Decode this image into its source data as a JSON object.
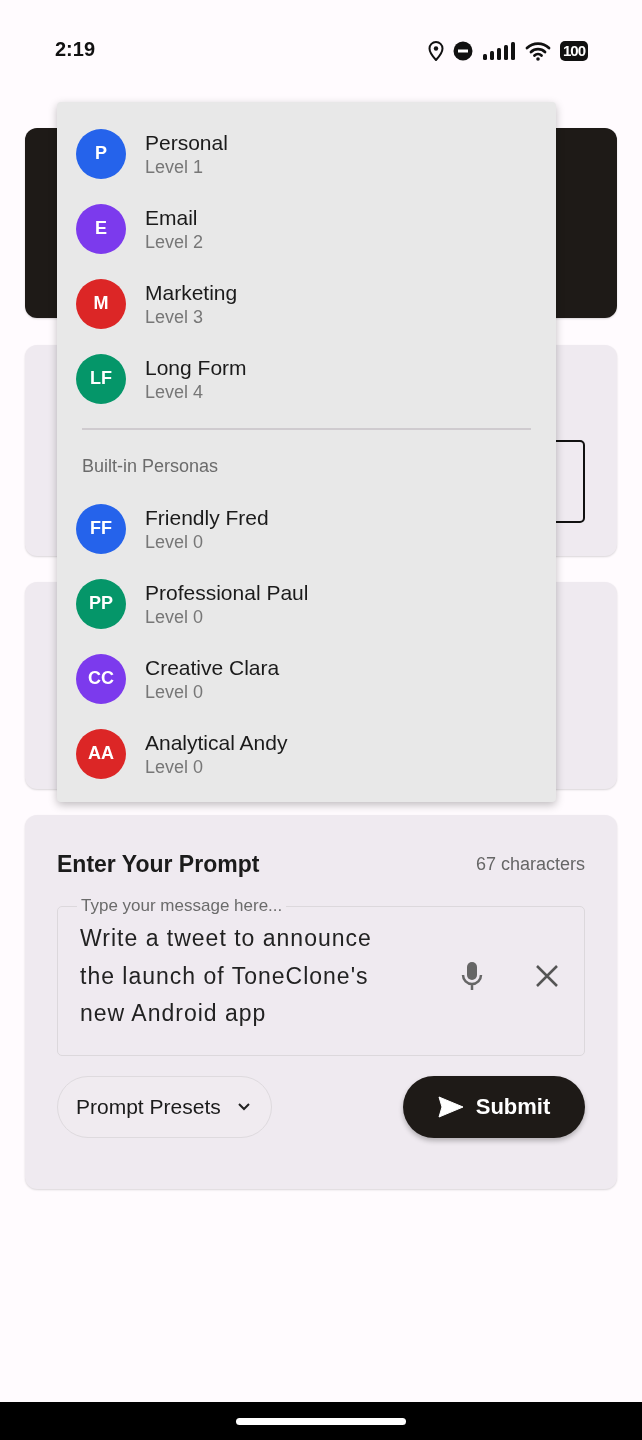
{
  "status_bar": {
    "time": "2:19",
    "battery": "100"
  },
  "persona_menu": {
    "open": true,
    "custom_personas": [
      {
        "initials": "P",
        "name": "Personal",
        "level": "Level 1",
        "color": "#2563eb"
      },
      {
        "initials": "E",
        "name": "Email",
        "level": "Level 2",
        "color": "#7c3aed"
      },
      {
        "initials": "M",
        "name": "Marketing",
        "level": "Level 3",
        "color": "#dc2626"
      },
      {
        "initials": "LF",
        "name": "Long Form",
        "level": "Level 4",
        "color": "#059669"
      }
    ],
    "section_title": "Built-in Personas",
    "built_in_personas": [
      {
        "initials": "FF",
        "name": "Friendly Fred",
        "level": "Level 0",
        "color": "#2563eb"
      },
      {
        "initials": "PP",
        "name": "Professional Paul",
        "level": "Level 0",
        "color": "#059669"
      },
      {
        "initials": "CC",
        "name": "Creative Clara",
        "level": "Level 0",
        "color": "#7c3aed"
      },
      {
        "initials": "AA",
        "name": "Analytical Andy",
        "level": "Level 0",
        "color": "#dc2626"
      }
    ]
  },
  "prompt_card": {
    "title": "Enter Your Prompt",
    "char_count": "67 characters",
    "field_label": "Type your message here...",
    "value": "Write a tweet to announce the launch of ToneClone's new Android app",
    "presets_button": "Prompt Presets",
    "submit_button": "Submit"
  }
}
